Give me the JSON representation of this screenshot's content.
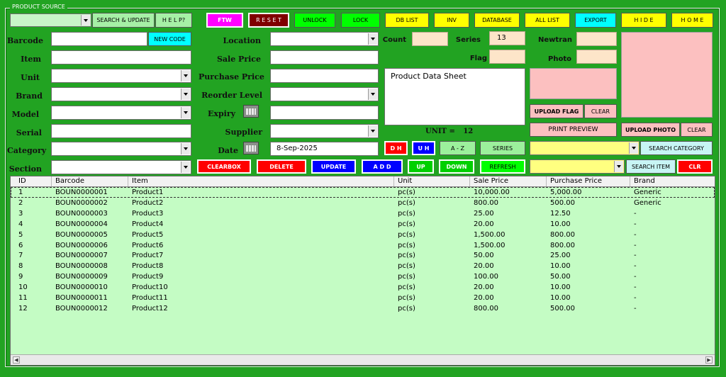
{
  "window": {
    "group_title": "PRODUCT SOURCE"
  },
  "top_buttons": {
    "search_update": "SEARCH & UPDATE",
    "help": "H E L P?",
    "ftw": "FTW",
    "reset": "R E S E T",
    "unlock": "UNLOCK",
    "lock": "LOCK",
    "db_list": "DB LIST",
    "inv": "INV",
    "database": "DATABASE",
    "all_list": "ALL LIST",
    "export": "EXPORT",
    "hide": "H I D E",
    "home": "H O M E"
  },
  "left_labels": {
    "barcode": "Barcode",
    "item": "Item",
    "unit": "Unit",
    "brand": "Brand",
    "model": "Model",
    "serial": "Serial",
    "category": "Category",
    "section": "Section"
  },
  "new_code_button": "NEW CODE",
  "mid_labels": {
    "location": "Location",
    "sale_price": "Sale Price",
    "purchase_price": "Purchase Price",
    "reorder_level": "Reorder Level",
    "expiry": "Expiry",
    "supplier": "Supplier",
    "date": "Date"
  },
  "date_value": "8-Sep-2025",
  "right_labels": {
    "count": "Count",
    "series": "Series",
    "newtran": "Newtran",
    "flag": "Flag",
    "photo": "Photo"
  },
  "series_value": "13",
  "sheet_title": "Product Data Sheet",
  "unit_summary": {
    "label": "UNIT  =",
    "value": "12"
  },
  "small_buttons": {
    "dh": "D H",
    "uh": "U H",
    "az": "A - Z",
    "series": "SERIES",
    "upload_flag": "UPLOAD FLAG",
    "clear_flag": "CLEAR",
    "print_preview": "PRINT   PREVIEW",
    "upload_photo": "UPLOAD PHOTO",
    "clear_photo": "CLEAR",
    "search_category": "SEARCH CATEGORY",
    "search_item": "SEARCH ITEM",
    "clr": "CLR"
  },
  "action_buttons": {
    "clearbox": "CLEARBOX",
    "delete": "DELETE",
    "update": "UPDATE",
    "add": "A D D",
    "up": "UP",
    "down": "DOWN",
    "refresh": "REFRESH"
  },
  "table": {
    "columns": [
      "ID",
      "Barcode",
      "Item",
      "Unit",
      "Sale Price",
      "Purchase Price",
      "Brand"
    ],
    "rows": [
      [
        "1",
        "BOUN0000001",
        "Product1",
        "pc(s)",
        "10,000.00",
        "5,000.00",
        "Generic"
      ],
      [
        "2",
        "BOUN0000002",
        "Product2",
        "pc(s)",
        "800.00",
        "500.00",
        "Generic"
      ],
      [
        "3",
        "BOUN0000003",
        "Product3",
        "pc(s)",
        "25.00",
        "12.50",
        "-"
      ],
      [
        "4",
        "BOUN0000004",
        "Product4",
        "pc(s)",
        "20.00",
        "10.00",
        "-"
      ],
      [
        "5",
        "BOUN0000005",
        "Product5",
        "pc(s)",
        "1,500.00",
        "800.00",
        "-"
      ],
      [
        "6",
        "BOUN0000006",
        "Product6",
        "pc(s)",
        "1,500.00",
        "800.00",
        "-"
      ],
      [
        "7",
        "BOUN0000007",
        "Product7",
        "pc(s)",
        "50.00",
        "25.00",
        "-"
      ],
      [
        "8",
        "BOUN0000008",
        "Product8",
        "pc(s)",
        "20.00",
        "10.00",
        "-"
      ],
      [
        "9",
        "BOUN0000009",
        "Product9",
        "pc(s)",
        "100.00",
        "50.00",
        "-"
      ],
      [
        "10",
        "BOUN0000010",
        "Product10",
        "pc(s)",
        "20.00",
        "10.00",
        "-"
      ],
      [
        "11",
        "BOUN0000011",
        "Product11",
        "pc(s)",
        "20.00",
        "10.00",
        "-"
      ],
      [
        "12",
        "BOUN0000012",
        "Product12",
        "pc(s)",
        "800.00",
        "500.00",
        "-"
      ]
    ]
  },
  "colors": {
    "background": "#22a322",
    "table_bg": "#c4fcc4",
    "pink_preview": "#fcc0c0",
    "peach": "#fde5c9",
    "yellow": "#ffff00",
    "lime": "#00ff00",
    "cyan": "#00ffff",
    "magenta": "#ff00ff",
    "maroon": "#800000",
    "red": "#ff0000",
    "blue": "#0000ff"
  }
}
